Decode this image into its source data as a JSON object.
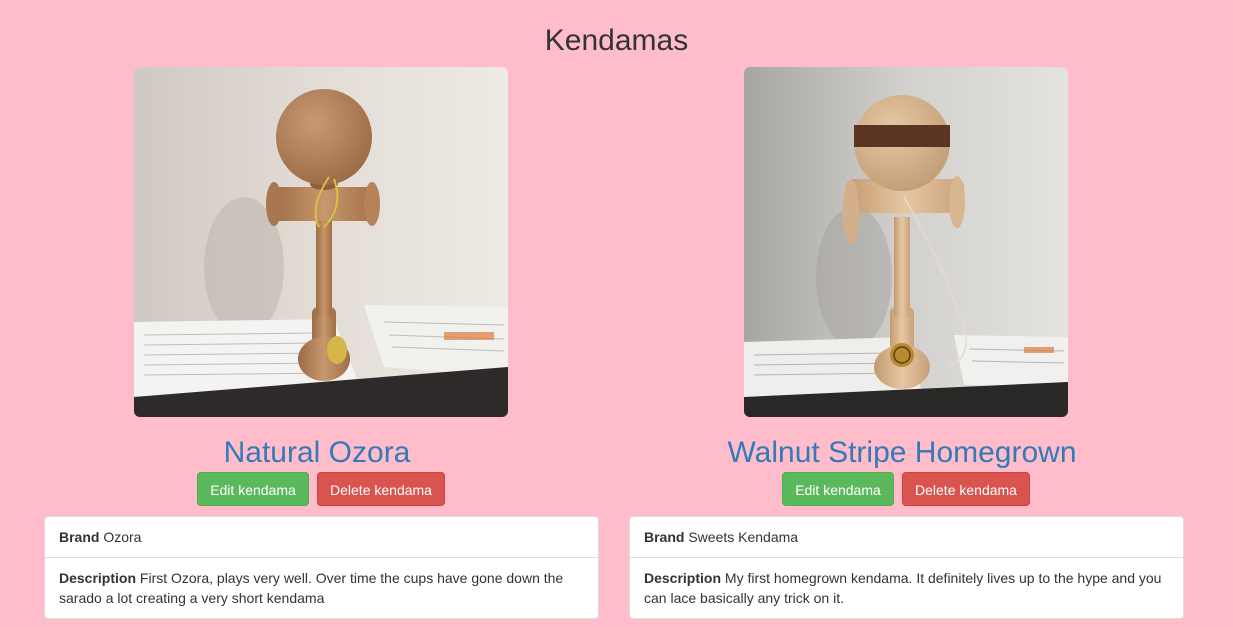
{
  "page": {
    "title": "Kendamas"
  },
  "kendamas": [
    {
      "name": "Natural Ozora",
      "edit_label": "Edit kendama",
      "delete_label": "Delete kendama",
      "brand_label": "Brand",
      "brand": "Ozora",
      "description_label": "Description",
      "description": "First Ozora, plays very well. Over time the cups have gone down the sarado a lot creating a very short kendama"
    },
    {
      "name": "Walnut Stripe Homegrown",
      "edit_label": "Edit kendama",
      "delete_label": "Delete kendama",
      "brand_label": "Brand",
      "brand": "Sweets Kendama",
      "description_label": "Description",
      "description": "My first homegrown kendama. It definitely lives up to the hype and you can lace basically any trick on it."
    }
  ],
  "colors": {
    "background": "#ffbdcb",
    "link": "#337ab7",
    "success": "#5cb85c",
    "danger": "#d9534f"
  }
}
